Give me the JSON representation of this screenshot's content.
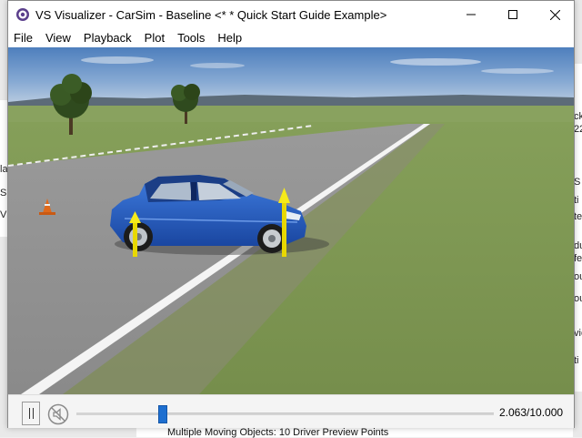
{
  "window": {
    "title": "VS Visualizer - CarSim - Baseline <* * Quick Start Guide Example>"
  },
  "menu": {
    "items": [
      "File",
      "View",
      "Playback",
      "Plot",
      "Tools",
      "Help"
    ]
  },
  "playback": {
    "time_readout": "2.063/10.000",
    "current_time": 2.063,
    "end_time": 10.0,
    "progress_fraction": 0.206,
    "paused": false,
    "muted": true
  },
  "background": {
    "bottom_text": "Multiple Moving Objects: 10 Driver Preview Points",
    "left_fragments": [
      "la",
      "S",
      "V"
    ],
    "right_fragments": [
      "ck",
      "22",
      "S",
      "ti",
      "te",
      "du",
      "fe",
      "ou",
      "ou",
      "vie",
      "ti"
    ]
  },
  "colors": {
    "car_body": "#1f56b8",
    "arrow": "#f2e600",
    "slider_thumb": "#1e6fd0",
    "sky_top": "#5a88c0",
    "grass": "#7f9a55",
    "road": "#8e8e8e"
  },
  "icons": {
    "app": "vs-visualizer-app-icon",
    "minimize": "minimize-icon",
    "maximize": "maximize-icon",
    "close": "close-icon",
    "pause": "pause-icon",
    "mute": "mute-icon"
  }
}
